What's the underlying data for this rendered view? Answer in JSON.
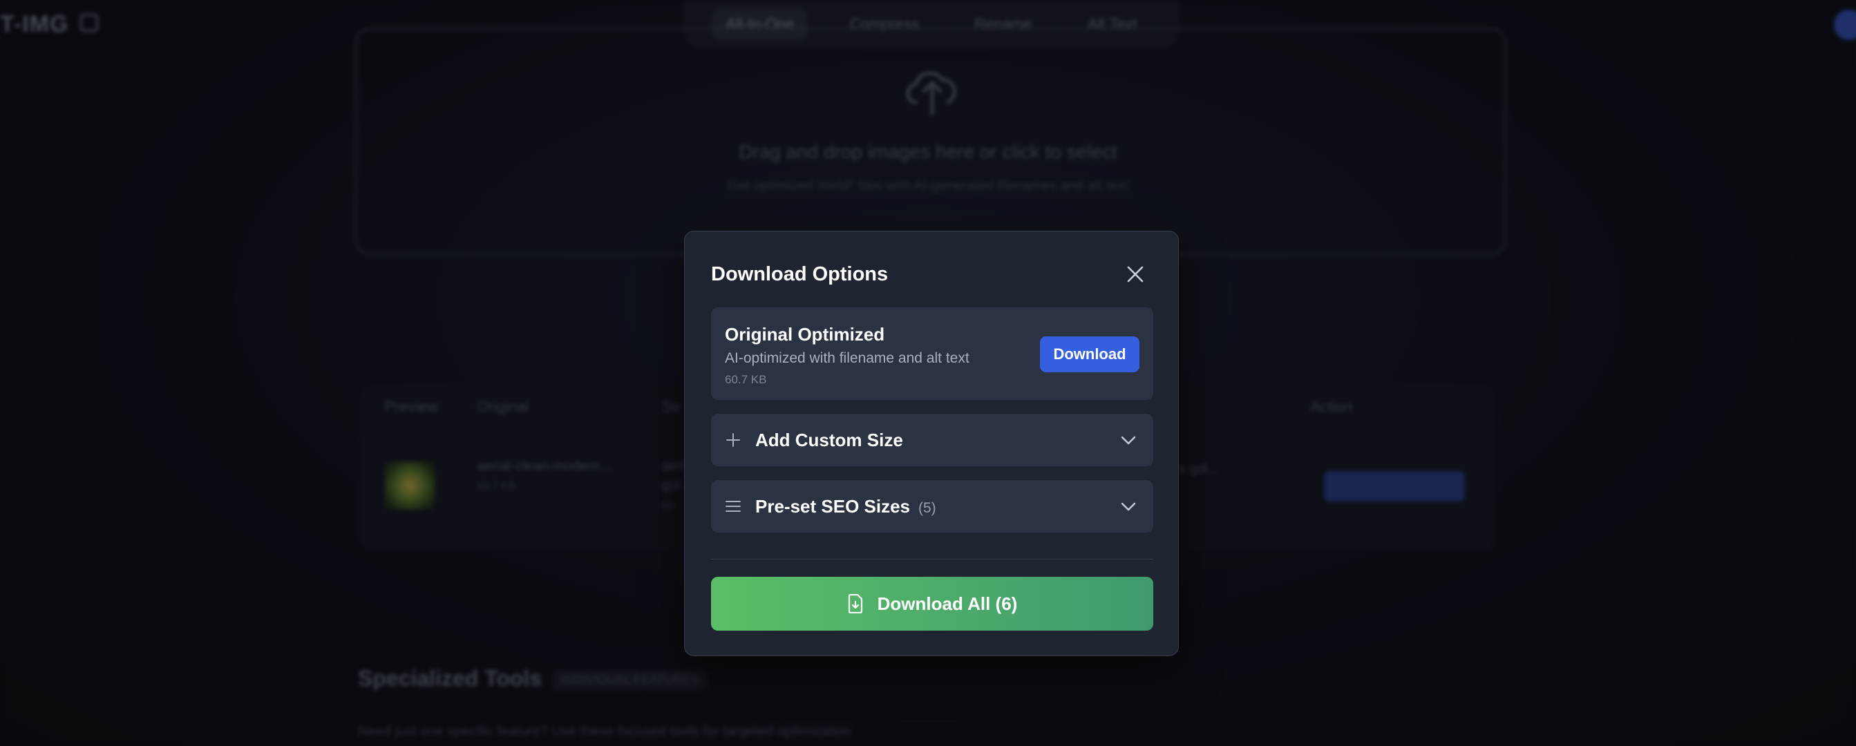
{
  "background": {
    "logo": "T-IMG",
    "nav": [
      "All-In-One",
      "Compress",
      "Rename",
      "Alt Text"
    ],
    "dropzone": {
      "title": "Drag and drop images here or click to select",
      "subtitle": "Get optimized WebP files with AI-generated filenames and alt text"
    },
    "table": {
      "headers": [
        "Preview",
        "Original",
        "Se",
        "Action"
      ],
      "row": {
        "original_name": "aerial-clean-modern...",
        "original_size": "60.7 KB",
        "seo_name_1": "aeri",
        "seo_name_2": "gol",
        "seo_meta": "60",
        "alt_excerpt": "... of a gol...",
        "action": "Download Options"
      }
    },
    "tools": {
      "title": "Specialized Tools",
      "badge": "INDIVIDUAL FEATURES",
      "subtitle": "Need just one specific feature? Use these focused tools for targeted optimization"
    }
  },
  "modal": {
    "title": "Download Options",
    "original": {
      "title": "Original Optimized",
      "description": "AI-optimized with filename and alt text",
      "size": "60.7 KB",
      "button": "Download"
    },
    "custom": {
      "label": "Add Custom Size"
    },
    "preset": {
      "label": "Pre-set SEO Sizes",
      "count": "(5)"
    },
    "download_all": "Download All (6)"
  },
  "colors": {
    "accent_blue": "#3460e0",
    "download_all_start": "#5bbf66",
    "download_all_end": "#3f9a6e",
    "modal_bg": "#1e2531",
    "card_bg": "#2b3342"
  },
  "icons": {
    "close": "close-icon",
    "custom": "plus-icon",
    "preset": "list-icon",
    "chevron": "chevron-down-icon",
    "download_all": "file-download-icon"
  }
}
